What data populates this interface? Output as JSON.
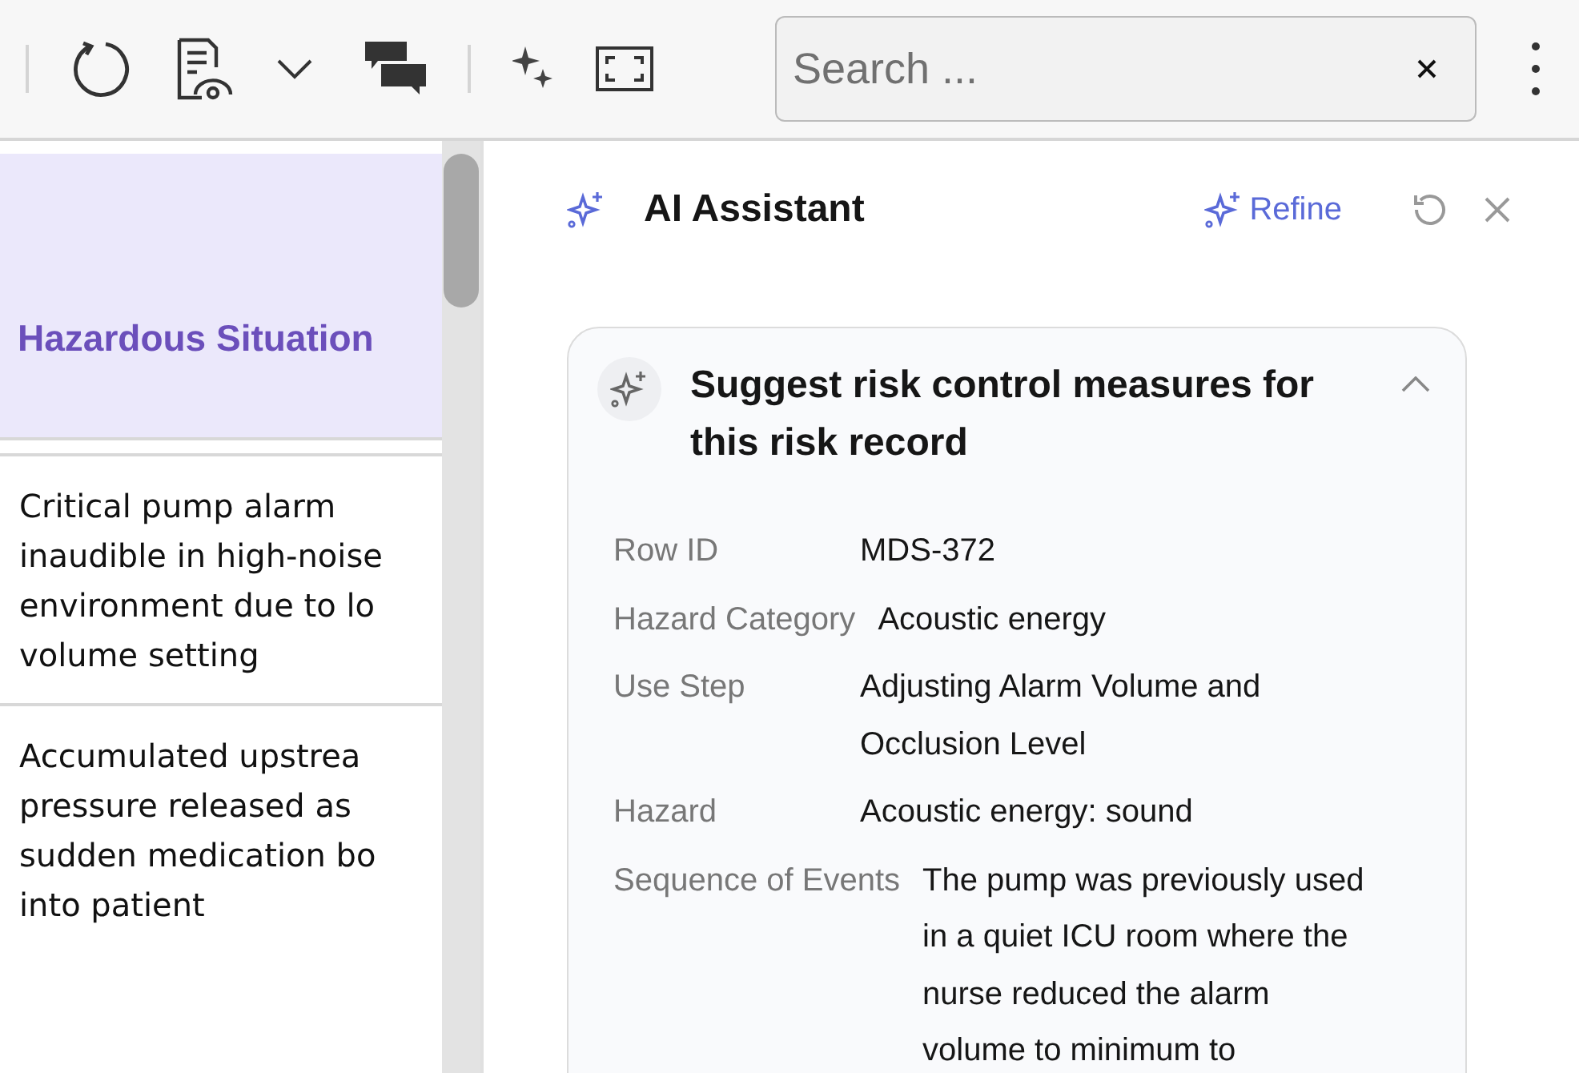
{
  "toolbar": {
    "search": {
      "placeholder": "Search ..."
    }
  },
  "table": {
    "header": {
      "label": "Hazardous Situation",
      "selected": true
    },
    "rows": [
      {
        "lines": [
          "Critical pump alarm",
          "inaudible in high-noise",
          "environment due to lo",
          "volume setting"
        ]
      },
      {
        "lines": [
          "Accumulated upstrea",
          "pressure released as",
          "sudden medication bo",
          "into patient"
        ]
      }
    ]
  },
  "assistant": {
    "title": "AI Assistant",
    "refine": "Refine",
    "card": {
      "title": "Suggest risk control measures for this risk record",
      "expanded": true,
      "fields": [
        {
          "label": "Row ID",
          "value": "MDS-372"
        },
        {
          "label": "Hazard Category",
          "value": "Acoustic energy"
        },
        {
          "label": "Use Step",
          "value": "Adjusting Alarm Volume and Occlusion Level"
        },
        {
          "label": "Hazard",
          "value": "Acoustic energy: sound"
        },
        {
          "label": "Sequence of Events",
          "value": "The pump was previously used in a quiet ICU room where the nurse reduced the alarm volume to minimum to"
        }
      ]
    }
  }
}
